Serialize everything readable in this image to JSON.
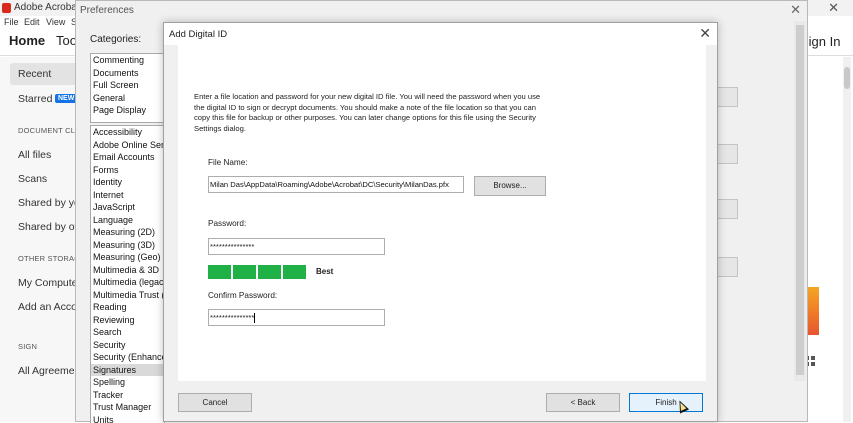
{
  "acrobat": {
    "title": "Adobe Acrobat R",
    "menu": [
      "File",
      "Edit",
      "View",
      "S"
    ],
    "tabs": {
      "home": "Home",
      "tools": "Tool"
    },
    "sign_in": "Sign In",
    "left_panel": {
      "recent": "Recent",
      "starred": "Starred",
      "new_badge": "NEW",
      "document_cloud_header": "DOCUMENT CLO",
      "all_files": "All files",
      "scans": "Scans",
      "shared_by_you": "Shared by you",
      "shared_by_others": "Shared by oth",
      "other_storage_header": "OTHER STORAG",
      "my_computer": "My Computer",
      "add_account": "Add an Accou",
      "sign_header": "SIGN",
      "all_agreements": "All Agreemen"
    }
  },
  "preferences": {
    "title": "Preferences",
    "categories_label": "Categories:",
    "categories_top": [
      "Commenting",
      "Documents",
      "Full Screen",
      "General",
      "Page Display"
    ],
    "categories_bottom": [
      "Accessibility",
      "Adobe Online Servic",
      "Email Accounts",
      "Forms",
      "Identity",
      "Internet",
      "JavaScript",
      "Language",
      "Measuring (2D)",
      "Measuring (3D)",
      "Measuring (Geo)",
      "Multimedia & 3D",
      "Multimedia (legacy)",
      "Multimedia Trust (leg",
      "Reading",
      "Reviewing",
      "Search",
      "Security",
      "Security (Enhanced)",
      "Signatures",
      "Spelling",
      "Tracker",
      "Trust Manager",
      "Units"
    ],
    "selected_category": "Signatures"
  },
  "dialog": {
    "title": "Add Digital ID",
    "description": "Enter a file location and password for your new digital ID file. You will need the password when you use the digital ID to sign or decrypt documents. You should make a note of the file location so that you can copy this file for backup or other purposes. You can later change options for this file using the Security Settings dialog.",
    "file_name_label": "File Name:",
    "file_name_value": "Milan Das\\AppData\\Roaming\\Adobe\\Acrobat\\DC\\Security\\MilanDas.pfx",
    "browse_label": "Browse...",
    "password_label": "Password:",
    "password_value": "***************",
    "strength_label": "Best",
    "strength_color": "#20b146",
    "confirm_password_label": "Confirm Password:",
    "confirm_password_value": "***************",
    "cancel_label": "Cancel",
    "back_label": "< Back",
    "finish_label": "Finish"
  }
}
